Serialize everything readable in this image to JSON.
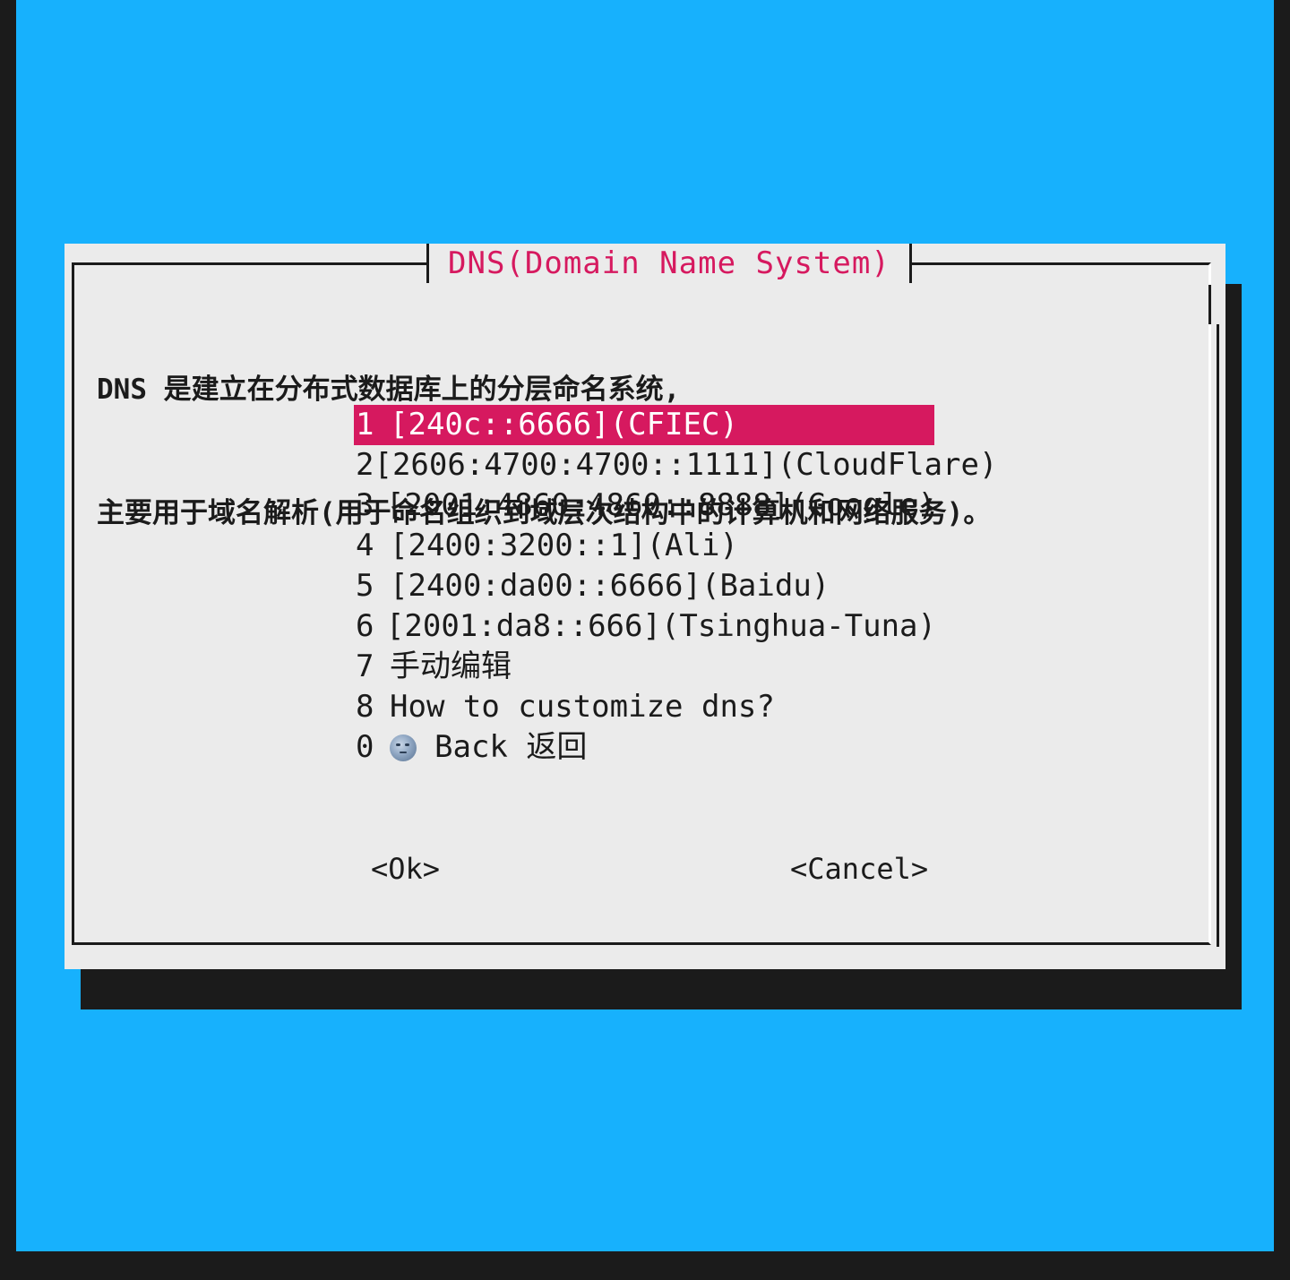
{
  "dialog": {
    "title": "DNS(Domain Name System)",
    "description_line1": "DNS 是建立在分布式数据库上的分层命名系统,",
    "description_line2": "主要用于域名解析(用于命名组织到域层次结构中的计算机和网络服务)。"
  },
  "menu": {
    "selected_index": 0,
    "items": [
      {
        "tag": "1",
        "label": "[240c::6666](CFIEC)"
      },
      {
        "tag": "2",
        "label": "[2606:4700:4700::1111](CloudFlare)"
      },
      {
        "tag": "3",
        "label": "[2001:4860:4860::8888](Google)"
      },
      {
        "tag": "4",
        "label": "[2400:3200::1](Ali)"
      },
      {
        "tag": "5",
        "label": "[2400:da00::6666](Baidu)"
      },
      {
        "tag": "6",
        "label": "[2001:da8::666](Tsinghua-Tuna)"
      },
      {
        "tag": "7",
        "label": "手动编辑"
      },
      {
        "tag": "8",
        "label": "How to customize dns?"
      },
      {
        "tag": "0",
        "icon": "moon-face-icon",
        "label": "Back 返回"
      }
    ]
  },
  "buttons": {
    "ok": "<Ok>",
    "cancel": "<Cancel>"
  },
  "colors": {
    "terminal_background": "#17b1fd",
    "dialog_background": "#ebebeb",
    "accent": "#d6195f",
    "shadow": "#1b1b1b"
  }
}
